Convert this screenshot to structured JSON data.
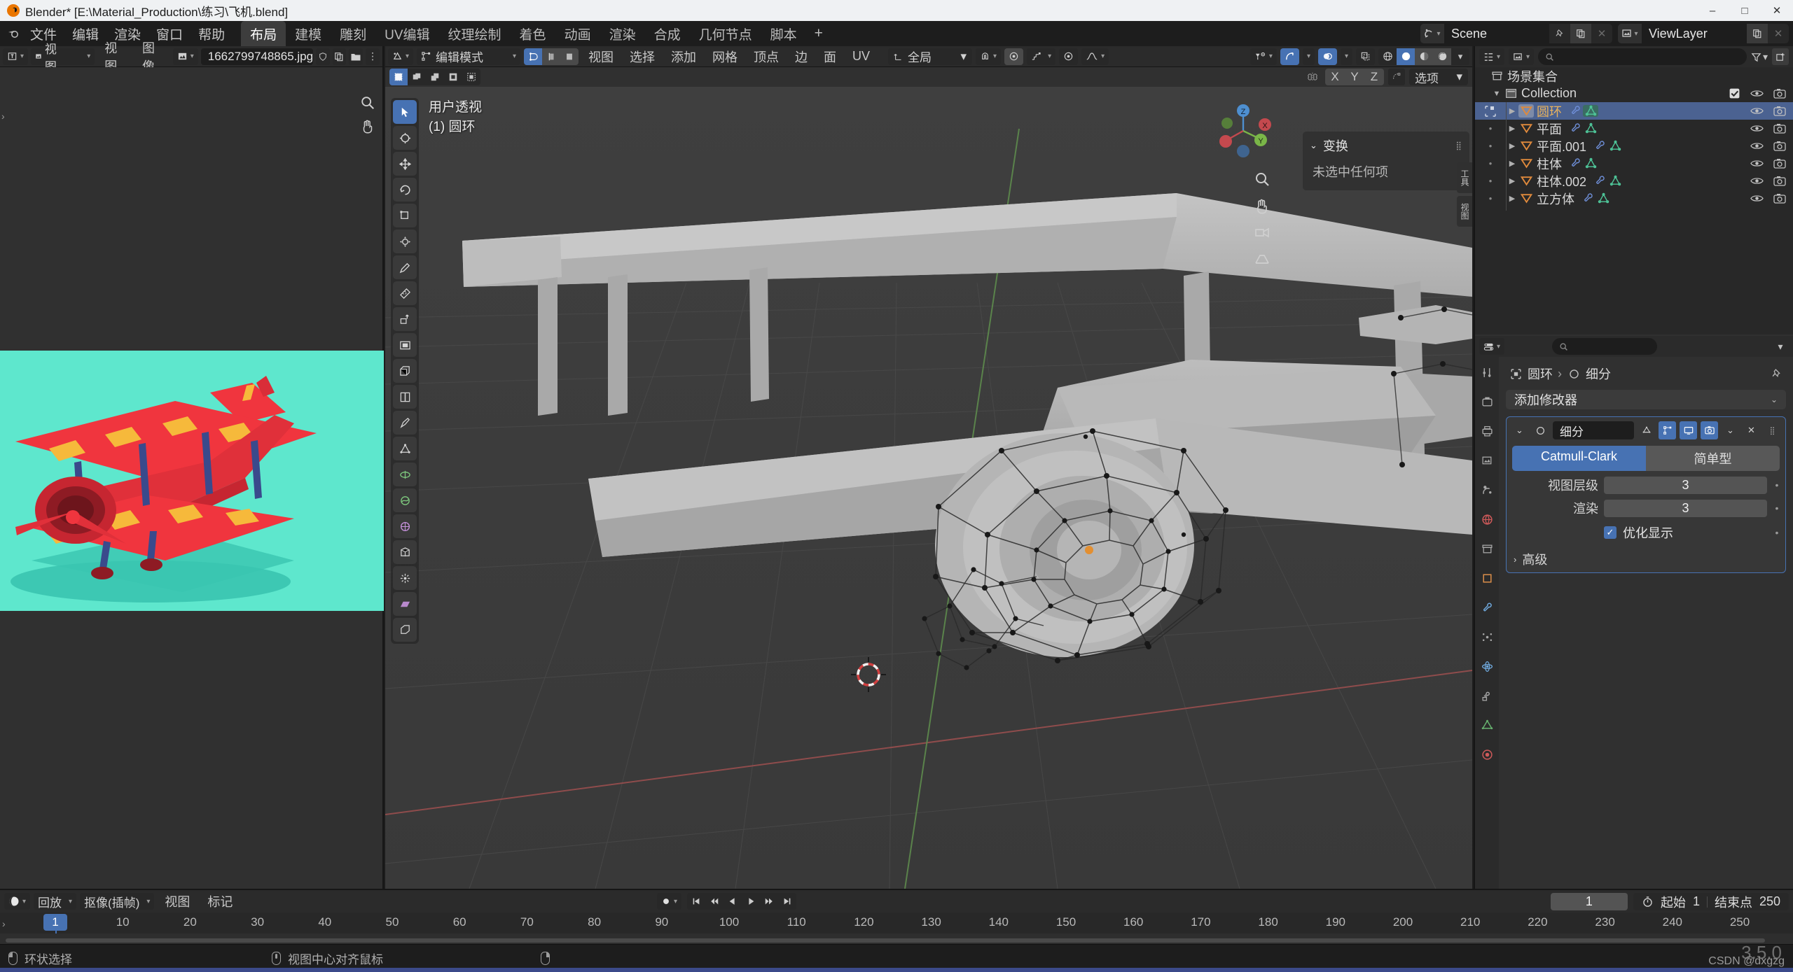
{
  "window": {
    "title": "Blender* [E:\\Material_Production\\练习\\飞机.blend]",
    "minimize": "–",
    "maximize": "□",
    "close": "✕"
  },
  "topbar": {
    "menus": [
      "文件",
      "编辑",
      "渲染",
      "窗口",
      "帮助"
    ],
    "workspaces": [
      "布局",
      "建模",
      "雕刻",
      "UV编辑",
      "纹理绘制",
      "着色",
      "动画",
      "渲染",
      "合成",
      "几何节点",
      "脚本"
    ],
    "active_workspace": "布局",
    "add_workspace": "+",
    "scene_name": "Scene",
    "viewlayer_name": "ViewLayer"
  },
  "image_editor": {
    "mode_label": "视图",
    "menus": [
      "视图",
      "图像"
    ],
    "image_name": "1662799748865.jpg",
    "canvas_bg": "#5ee7cd"
  },
  "viewport": {
    "mode": "编辑模式",
    "menus": [
      "视图",
      "选择",
      "添加",
      "网格",
      "顶点",
      "边",
      "面",
      "UV"
    ],
    "orientation": "全局",
    "options_label": "选项",
    "mirror_axes": [
      "X",
      "Y",
      "Z"
    ],
    "overlay_line1": "用户透视",
    "overlay_line2": "(1) 圆环",
    "npanel": {
      "title": "变换",
      "empty_text": "未选中任何项",
      "tabs": [
        "工具",
        "视图"
      ]
    },
    "gizmo_axes": [
      "X",
      "Y",
      "Z"
    ]
  },
  "outliner": {
    "search_placeholder": "",
    "scene_collection": "场景集合",
    "collection": "Collection",
    "items": [
      {
        "name": "圆环",
        "selected": true
      },
      {
        "name": "平面",
        "selected": false
      },
      {
        "name": "平面.001",
        "selected": false
      },
      {
        "name": "柱体",
        "selected": false
      },
      {
        "name": "柱体.002",
        "selected": false
      },
      {
        "name": "立方体",
        "selected": false
      }
    ]
  },
  "properties": {
    "breadcrumb_object": "圆环",
    "breadcrumb_modifier": "细分",
    "add_modifier": "添加修改器",
    "modifier": {
      "name": "细分",
      "type_a": "Catmull-Clark",
      "type_b": "简单型",
      "viewport_levels_label": "视图层级",
      "viewport_levels_value": "3",
      "render_label": "渲染",
      "render_value": "3",
      "optimal_display_label": "优化显示",
      "optimal_display_checked": true,
      "advanced_label": "高级"
    }
  },
  "timeline": {
    "menus": [
      "回放",
      "抠像(插帧)",
      "视图",
      "标记"
    ],
    "current_frame": "1",
    "start_label": "起始",
    "start_value": "1",
    "end_label": "结束点",
    "end_value": "250",
    "ticks": [
      "1",
      "10",
      "20",
      "30",
      "40",
      "50",
      "60",
      "70",
      "80",
      "90",
      "100",
      "110",
      "120",
      "130",
      "140",
      "150",
      "160",
      "170",
      "180",
      "190",
      "200",
      "210",
      "220",
      "230",
      "240",
      "250"
    ]
  },
  "statusbar": {
    "hint1": "环状选择",
    "hint2": "视图中心对齐鼠标",
    "watermark": "CSDN @dxgzg",
    "watermark_num": "3.5.0"
  }
}
